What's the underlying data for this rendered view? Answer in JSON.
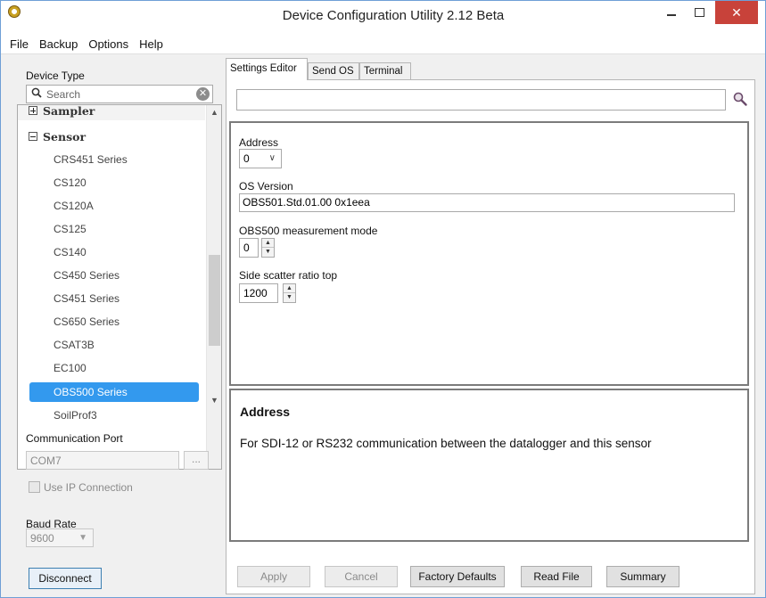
{
  "window": {
    "title": "Device Configuration Utility 2.12 Beta",
    "close_glyph": "✕"
  },
  "menu": {
    "items": [
      "File",
      "Backup",
      "Options",
      "Help"
    ]
  },
  "left": {
    "device_type_label": "Device Type",
    "search_placeholder": "Search",
    "clear_glyph": "✕",
    "groups": [
      {
        "label": "Sampler",
        "expanded": false
      },
      {
        "label": "Sensor",
        "expanded": true
      }
    ],
    "items": [
      "CRS451 Series",
      "CS120",
      "CS120A",
      "CS125",
      "CS140",
      "CS450 Series",
      "CS451 Series",
      "CS650 Series",
      "CSAT3B",
      "EC100",
      "OBS500 Series",
      "SoilProf3"
    ],
    "selected_item": "OBS500 Series",
    "comm_port_label": "Communication Port",
    "comm_port_value": "COM7",
    "browse_label": "...",
    "use_ip_label": "Use IP Connection",
    "baud_rate_label": "Baud Rate",
    "baud_rate_value": "9600",
    "disconnect_label": "Disconnect"
  },
  "tabs": [
    "Settings Editor",
    "Send OS",
    "Terminal"
  ],
  "active_tab": "Settings Editor",
  "settings": {
    "search_value": "",
    "address_label": "Address",
    "address_value": "0",
    "os_version_label": "OS Version",
    "os_version_value": "OBS501.Std.01.00 0x1eea",
    "mode_label": "OBS500 measurement mode",
    "mode_value": "0",
    "side_scatter_label": "Side scatter ratio top",
    "side_scatter_value": "1200"
  },
  "help": {
    "title": "Address",
    "description": "For SDI-12 or RS232 communication between the datalogger and this sensor"
  },
  "buttons": {
    "apply": "Apply",
    "cancel": "Cancel",
    "factory_defaults": "Factory Defaults",
    "read_file": "Read File",
    "summary": "Summary"
  }
}
